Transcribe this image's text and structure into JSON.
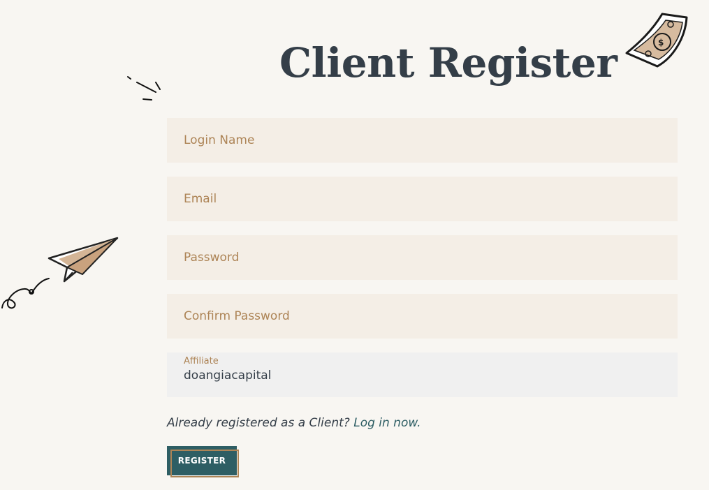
{
  "page": {
    "title": "Client Register"
  },
  "form": {
    "login_name_placeholder": "Login Name",
    "email_placeholder": "Email",
    "password_placeholder": "Password",
    "confirm_password_placeholder": "Confirm Password",
    "affiliate_label": "Affiliate",
    "affiliate_value": "doangiacapital"
  },
  "login_prompt": {
    "text": "Already registered as a Client?",
    "link": "Log in now."
  },
  "register_button": {
    "label": "REGISTER"
  },
  "decorations": {
    "top_right": "dollar-bill-icon",
    "left": "paper-plane-icon",
    "top_left": "sparkle-lines-icon"
  },
  "colors": {
    "background": "#f8f6f2",
    "title": "#343e48",
    "field_background": "#f4eee6",
    "affiliate_background": "#f0f0f0",
    "placeholder": "#ad8456",
    "button": "#2e5e64",
    "button_outline": "#ad8456"
  }
}
